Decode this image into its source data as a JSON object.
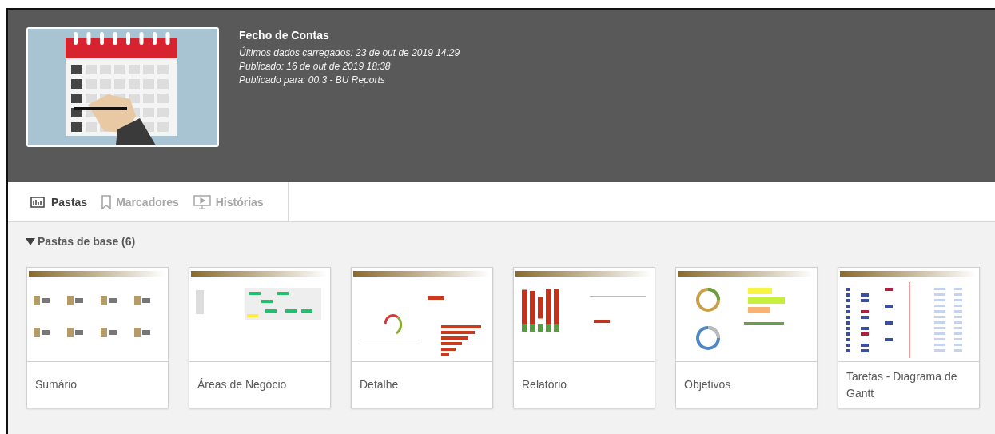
{
  "app": {
    "title": "Fecho de Contas",
    "details": [
      "Últimos dados carregados: 23 de out de 2019 14:29",
      "Publicado: 16 de out de 2019 18:38",
      "Publicado para: 00.3 - BU Reports"
    ]
  },
  "tabs": [
    {
      "label": "Pastas",
      "kind": "sheets",
      "selected": true
    },
    {
      "label": "Marcadores",
      "kind": "bookmarks",
      "selected": false
    },
    {
      "label": "Histórias",
      "kind": "stories",
      "selected": false
    }
  ],
  "section": {
    "title": "Pastas de base (6)",
    "expanded": true
  },
  "sheets": [
    {
      "title": "Sumário"
    },
    {
      "title": "Áreas de Negócio"
    },
    {
      "title": "Detalhe"
    },
    {
      "title": "Relatório"
    },
    {
      "title": "Objetivos"
    },
    {
      "title": "Tarefas - Diagrama de Gantt"
    }
  ]
}
